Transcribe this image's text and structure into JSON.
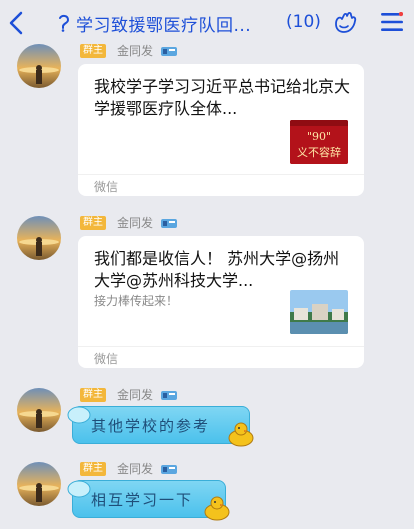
{
  "header": {
    "title": "学习致援鄂医疗队回...",
    "count": "(10)"
  },
  "messages": [
    {
      "badge": "群主",
      "sender": "金同发",
      "card": {
        "title": "我校学子学习习近平总书记给北京大学援鄂医疗队全体...",
        "thumb_text": "\"90\"",
        "thumb_text2": "义不容辞",
        "footer": "微信"
      }
    },
    {
      "badge": "群主",
      "sender": "金同发",
      "card": {
        "title": "我们都是收信人！ 苏州大学@扬州大学@苏州科技大学...",
        "subtitle": "接力棒传起来！",
        "footer": "微信"
      }
    },
    {
      "badge": "群主",
      "sender": "金同发",
      "text": "其他学校的参考"
    },
    {
      "badge": "群主",
      "sender": "金同发",
      "text": "相互学习一下"
    }
  ],
  "icons": {
    "back": "back-chevron-icon",
    "title": "chat-group-icon",
    "pet": "pet-hand-icon",
    "menu": "menu-icon"
  },
  "colors": {
    "accent": "#1d4fd8",
    "badge": "#f3b73b",
    "bubble": "#4bc1ec",
    "background": "#e9eaef"
  }
}
